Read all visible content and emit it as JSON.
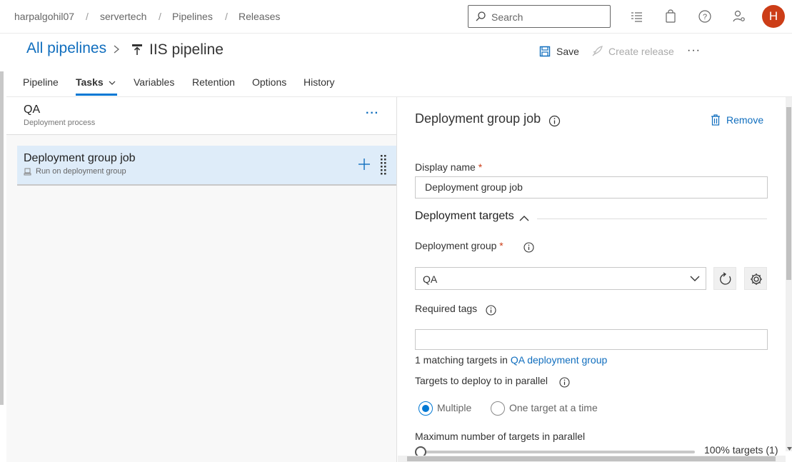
{
  "breadcrumb": {
    "org": "harpalgohil07",
    "project": "servertech",
    "section": "Pipelines",
    "page": "Releases",
    "separator": "/"
  },
  "search": {
    "placeholder": "Search"
  },
  "user": {
    "initial": "H",
    "avatar_color": "#cc3d17"
  },
  "header": {
    "all_pipelines": "All pipelines",
    "pipeline_name": "IIS pipeline",
    "save_label": "Save",
    "create_release_label": "Create release",
    "more": "···"
  },
  "tabs": [
    {
      "label": "Pipeline"
    },
    {
      "label": "Tasks",
      "active": true
    },
    {
      "label": "Variables"
    },
    {
      "label": "Retention"
    },
    {
      "label": "Options"
    },
    {
      "label": "History"
    }
  ],
  "stage": {
    "name": "QA",
    "subtitle": "Deployment process",
    "more": "···"
  },
  "job": {
    "name": "Deployment group job",
    "subtitle": "Run on deployment group"
  },
  "details": {
    "title": "Deployment group job",
    "remove_label": "Remove",
    "display_name_label": "Display name",
    "required_mark": "*",
    "display_name_value": "Deployment group job",
    "targets_section": "Deployment targets",
    "deployment_group_label": "Deployment group",
    "deployment_group_value": "QA",
    "required_tags_label": "Required tags",
    "required_tags_value": "",
    "matching_prefix": "1 matching targets in",
    "matching_link": "QA deployment group",
    "parallel_label": "Targets to deploy to in parallel",
    "radio_multiple": "Multiple",
    "radio_one": "One target at a time",
    "max_parallel_label": "Maximum number of targets in parallel",
    "max_parallel_value": "100% targets (1)",
    "max_parallel_fraction": 0.0
  },
  "colors": {
    "accent": "#0078d4",
    "link": "#106ebe",
    "selected_row": "#deecf9"
  }
}
